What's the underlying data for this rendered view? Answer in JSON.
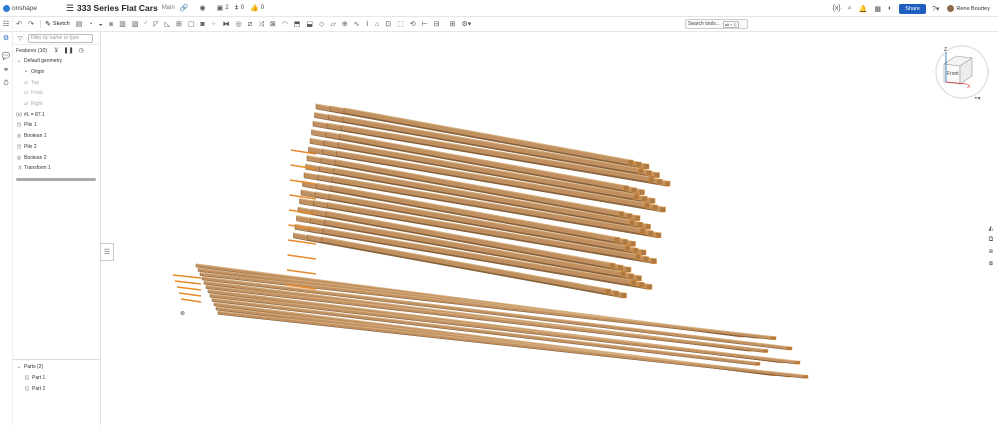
{
  "topbar": {
    "logo": "onshape",
    "doc_title": "333 Series Flat Cars",
    "branch": "Main",
    "counts": {
      "versions": "2",
      "branches": "0",
      "likes": "0"
    },
    "share_label": "Share",
    "user_name": "Rene Bourtey"
  },
  "toolbar": {
    "sketch_label": "Sketch",
    "search_tools": "Search tools...",
    "search_shortcut": "alt + C"
  },
  "panel": {
    "filter_placeholder": "Filter by name or type",
    "features_title": "Features (10)",
    "features": [
      {
        "label": "Default geometry",
        "icon": "chevron-down-icon"
      },
      {
        "label": "Origin",
        "icon": "origin-icon"
      },
      {
        "label": "Top",
        "icon": "plane-icon"
      },
      {
        "label": "Front",
        "icon": "plane-icon"
      },
      {
        "label": "Right",
        "icon": "plane-icon"
      },
      {
        "label": "#L = 87.1",
        "icon": "variable-icon"
      },
      {
        "label": "Pile 1",
        "icon": "custom-feature-icon"
      },
      {
        "label": "Boolean 1",
        "icon": "boolean-icon"
      },
      {
        "label": "Pile 2",
        "icon": "custom-feature-icon"
      },
      {
        "label": "Boolean 2",
        "icon": "boolean-icon"
      },
      {
        "label": "Transform 1",
        "icon": "transform-icon"
      }
    ],
    "parts_title": "Parts (2)",
    "parts": [
      {
        "label": "Part 1",
        "icon": "part-icon"
      },
      {
        "label": "Part 2",
        "icon": "part-icon"
      }
    ]
  },
  "viewcube": {
    "face": "Front",
    "axis_z": "Z",
    "axis_x": "X"
  },
  "colors": {
    "wood": "#c09060",
    "wood_dark": "#7a5530",
    "wood_light": "#d8b080",
    "edge": "#e88a2a",
    "accent": "#1f5fbf"
  }
}
